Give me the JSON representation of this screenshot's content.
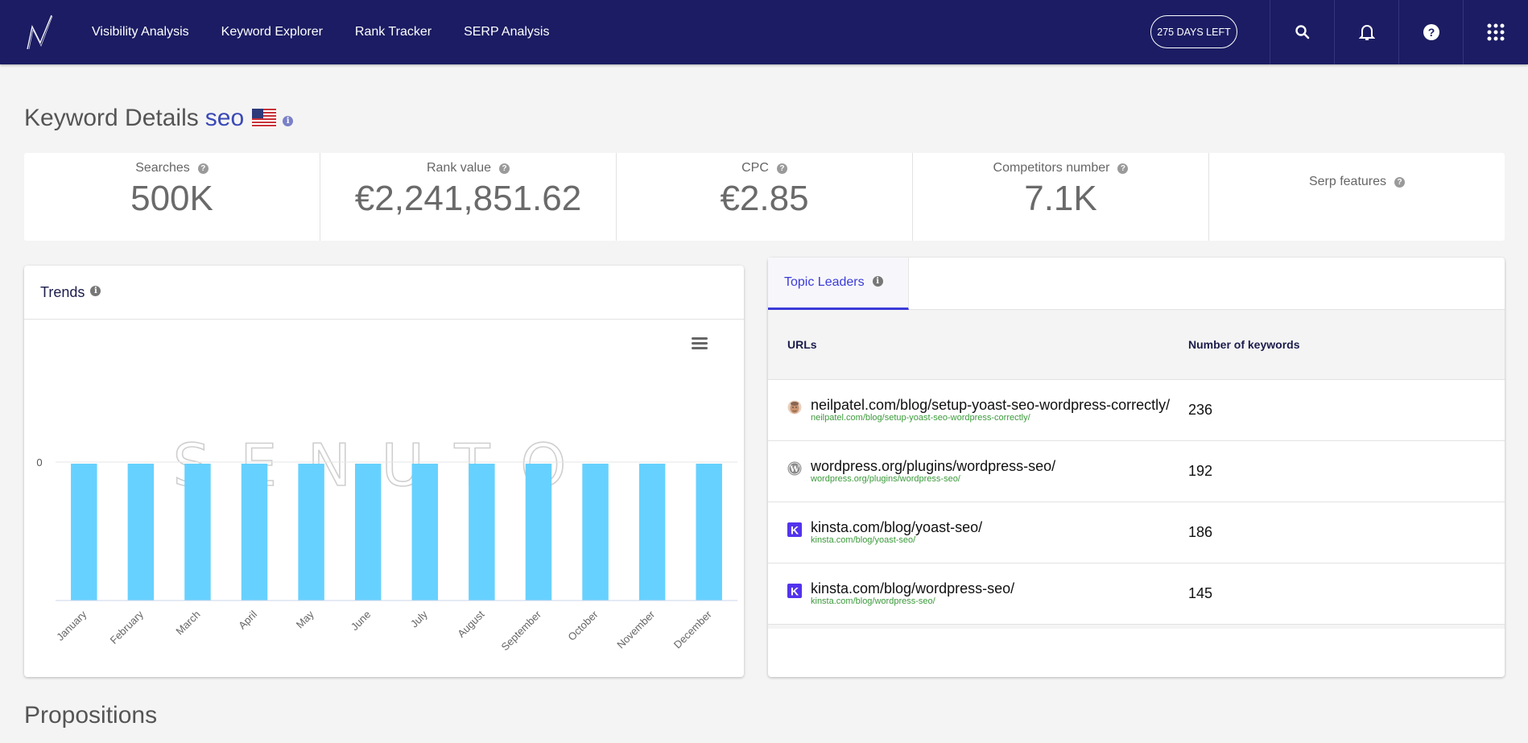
{
  "nav": {
    "items": [
      "Visibility Analysis",
      "Keyword Explorer",
      "Rank Tracker",
      "SERP Analysis"
    ],
    "days_left": "275 DAYS LEFT",
    "icons": [
      "search-icon",
      "bell-icon",
      "help-icon",
      "apps-grid-icon"
    ]
  },
  "header": {
    "title": "Keyword Details",
    "keyword": "seo",
    "country_flag": "us-flag-icon"
  },
  "stats": [
    {
      "label": "Searches",
      "value": "500K"
    },
    {
      "label": "Rank value",
      "value": "€2,241,851.62"
    },
    {
      "label": "CPC",
      "value": "€2.85"
    },
    {
      "label": "Competitors number",
      "value": "7.1K"
    },
    {
      "label": "Serp features",
      "value": ""
    }
  ],
  "trends": {
    "title": "Trends",
    "watermark": "SENUTO"
  },
  "chart_data": {
    "type": "bar",
    "title": "Trends",
    "categories": [
      "January",
      "February",
      "March",
      "April",
      "May",
      "June",
      "July",
      "August",
      "September",
      "October",
      "November",
      "December"
    ],
    "values": [
      0,
      0,
      0,
      0,
      0,
      0,
      0,
      0,
      0,
      0,
      0,
      0
    ],
    "y_ticks": [
      "0"
    ],
    "xlabel": "",
    "ylabel": "",
    "grid": true,
    "bar_color": "#66d1ff"
  },
  "topics": {
    "tab_label": "Topic Leaders",
    "columns": [
      "URLs",
      "Number of keywords"
    ],
    "rows": [
      {
        "url": "neilpatel.com/blog/setup-yoast-seo-wordpress-correctly/",
        "sub": "neilpatel.com/blog/setup-yoast-seo-wordpress-correctly/",
        "count": "236",
        "favicon": "neilpatel-avatar-icon"
      },
      {
        "url": "wordpress.org/plugins/wordpress-seo/",
        "sub": "wordpress.org/plugins/wordpress-seo/",
        "count": "192",
        "favicon": "wordpress-icon"
      },
      {
        "url": "kinsta.com/blog/yoast-seo/",
        "sub": "kinsta.com/blog/yoast-seo/",
        "count": "186",
        "favicon": "kinsta-icon"
      },
      {
        "url": "kinsta.com/blog/wordpress-seo/",
        "sub": "kinsta.com/blog/wordpress-seo/",
        "count": "145",
        "favicon": "kinsta-icon"
      }
    ]
  },
  "sections": {
    "propositions": "Propositions"
  },
  "colors": {
    "nav_bg": "#1b1c63",
    "accent": "#3b3bd9",
    "keyword": "#3a49b7",
    "bar": "#66d1ff",
    "url_sub": "#3b9a3b"
  }
}
